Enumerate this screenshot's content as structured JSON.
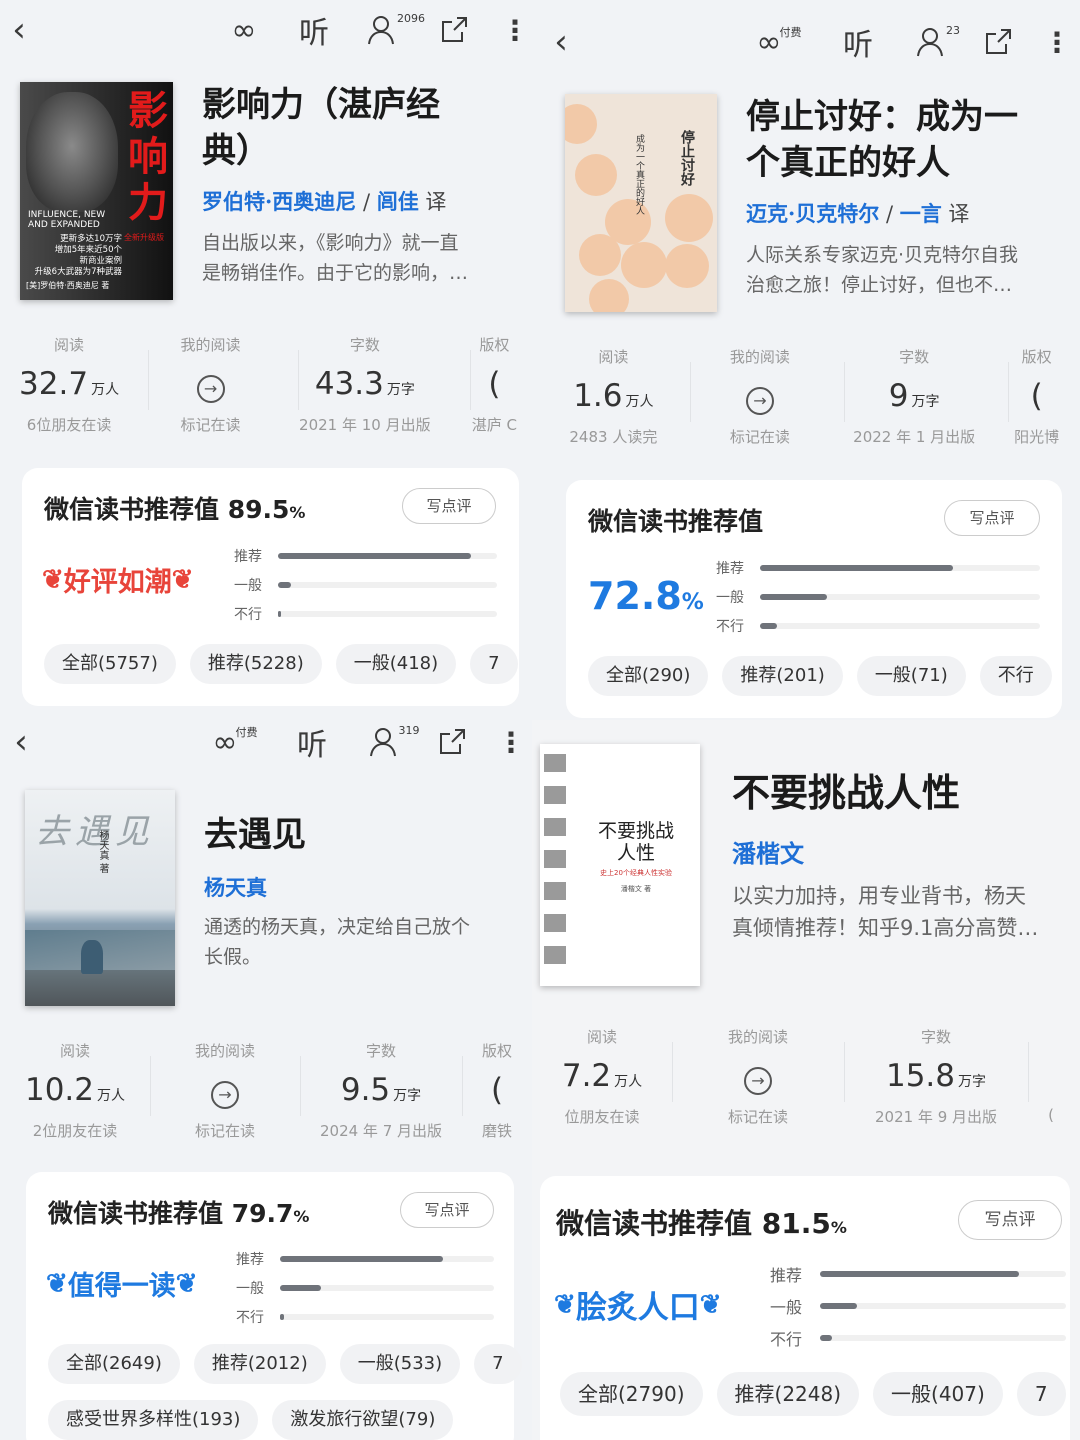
{
  "panels": [
    {
      "toolbar": {
        "back": "‹",
        "inf": "∞",
        "inf_badge": "",
        "listen": "听",
        "friend_count": "2096"
      },
      "book": {
        "title_l1": "影响力（湛庐经",
        "title_l2": "典）",
        "author": "罗伯特·西奥迪尼",
        "sep": " / ",
        "translator": "闾佳",
        "tr_suffix": " 译",
        "intro_l1": "自出版以来，《影响力》就一直",
        "intro_l2": "是畅销佳作。由于它的影响，…"
      },
      "cover": {
        "big": "影响力",
        "sub": "全新升级版",
        "en": "INFLUENCE, NEW AND EXPANDED",
        "l1": "更新多达10万字",
        "l2": "增加5年来近50个",
        "l3": "新商业案例",
        "l4": "升级6大武器为7种武器",
        "auth": "[美]罗伯特·西奥迪尼 著"
      },
      "stats": [
        {
          "label": "阅读",
          "value": "32.7",
          "unit": "万人",
          "sub": "6位朋友在读"
        },
        {
          "label": "我的阅读",
          "value": "",
          "unit": "",
          "sub": "标记在读"
        },
        {
          "label": "字数",
          "value": "43.3",
          "unit": "万字",
          "sub": "2021 年 10 月出版"
        },
        {
          "label": "版权",
          "value": "(",
          "unit": "",
          "sub": "湛庐 C"
        }
      ],
      "rating": {
        "title": "微信读书推荐值 89.5",
        "pct": "%",
        "write": "写点评",
        "badge": "好评如潮",
        "badge_color": "#e8443a",
        "labels": [
          "推荐",
          "一般",
          "不行"
        ],
        "fills": [
          0.88,
          0.06,
          0.01
        ],
        "chips": [
          "全部(5757)",
          "推荐(5228)",
          "一般(418)",
          "7"
        ]
      }
    },
    {
      "toolbar": {
        "back": "‹",
        "inf": "∞",
        "inf_badge": "付费",
        "listen": "听",
        "friend_count": "23"
      },
      "book": {
        "title_l1": "停止讨好：成为一",
        "title_l2": "个真正的好人",
        "author": "迈克·贝克特尔",
        "sep": " / ",
        "translator": "一言",
        "tr_suffix": " 译",
        "intro_l1": "人际关系专家迈克·贝克特尔自我",
        "intro_l2": "治愈之旅！停止讨好，但也不…"
      },
      "cover": {
        "t1": "停止",
        "t2": "讨好",
        "t3": "成为一个",
        "t4": "真正的好人"
      },
      "stats": [
        {
          "label": "阅读",
          "value": "1.6",
          "unit": "万人",
          "sub": "2483 人读完"
        },
        {
          "label": "我的阅读",
          "value": "",
          "unit": "",
          "sub": "标记在读"
        },
        {
          "label": "字数",
          "value": "9",
          "unit": "万字",
          "sub": "2022 年 1 月出版"
        },
        {
          "label": "版权",
          "value": "(",
          "unit": "",
          "sub": "阳光博"
        }
      ],
      "rating": {
        "title": "微信读书推荐值",
        "pct": "",
        "write": "写点评",
        "big": "72.8",
        "big_pct": "%",
        "labels": [
          "推荐",
          "一般",
          "不行"
        ],
        "fills": [
          0.69,
          0.24,
          0.06
        ],
        "chips": [
          "全部(290)",
          "推荐(201)",
          "一般(71)",
          "不行"
        ]
      }
    },
    {
      "toolbar": {
        "back": "‹",
        "inf": "∞",
        "inf_badge": "付费",
        "listen": "听",
        "friend_count": "319"
      },
      "book": {
        "title_l1": "去遇见",
        "title_l2": "",
        "author": "杨天真",
        "sep": "",
        "translator": "",
        "tr_suffix": "",
        "intro_l1": "通透的杨天真，决定给自己放个",
        "intro_l2": "长假。"
      },
      "cover": {
        "t1": "去遇见",
        "t2": "杨天真 著"
      },
      "stats": [
        {
          "label": "阅读",
          "value": "10.2",
          "unit": "万人",
          "sub": "2位朋友在读"
        },
        {
          "label": "我的阅读",
          "value": "",
          "unit": "",
          "sub": "标记在读"
        },
        {
          "label": "字数",
          "value": "9.5",
          "unit": "万字",
          "sub": "2024 年 7 月出版"
        },
        {
          "label": "版权",
          "value": "(",
          "unit": "",
          "sub": "磨铁"
        }
      ],
      "rating": {
        "title": "微信读书推荐值 79.7",
        "pct": "%",
        "write": "写点评",
        "badge": "值得一读",
        "badge_color": "#1e7ae0",
        "labels": [
          "推荐",
          "一般",
          "不行"
        ],
        "fills": [
          0.76,
          0.19,
          0.02
        ],
        "chips": [
          "全部(2649)",
          "推荐(2012)",
          "一般(533)",
          "7"
        ],
        "chips2": [
          "感受世界多样性(193)",
          "激发旅行欲望(79)"
        ]
      }
    },
    {
      "book": {
        "title_l1": "不要挑战人性",
        "title_l2": "",
        "author": "潘楷文",
        "sep": "",
        "translator": "",
        "tr_suffix": "",
        "intro_l1": "以实力加持，用专业背书，杨天",
        "intro_l2": "真倾情推荐！知乎9.1高分高赞…"
      },
      "cover": {
        "t1": "不要挑战",
        "t2": "人性",
        "t3": "史上20个经典人性实验",
        "t4": "潘楷文 著"
      },
      "stats": [
        {
          "label": "阅读",
          "value": "7.2",
          "unit": "万人",
          "sub": "位朋友在读"
        },
        {
          "label": "我的阅读",
          "value": "",
          "unit": "",
          "sub": "标记在读"
        },
        {
          "label": "字数",
          "value": "15.8",
          "unit": "万字",
          "sub": "2021 年 9 月出版"
        },
        {
          "label": "",
          "value": "",
          "unit": "",
          "sub": "("
        }
      ],
      "rating": {
        "title": "微信读书推荐值 81.5",
        "pct": "%",
        "write": "写点评",
        "badge": "脍炙人口",
        "badge_color": "#1e7ae0",
        "labels": [
          "推荐",
          "一般",
          "不行"
        ],
        "fills": [
          0.81,
          0.15,
          0.05
        ],
        "chips": [
          "全部(2790)",
          "推荐(2248)",
          "一般(407)",
          "7"
        ]
      }
    }
  ]
}
